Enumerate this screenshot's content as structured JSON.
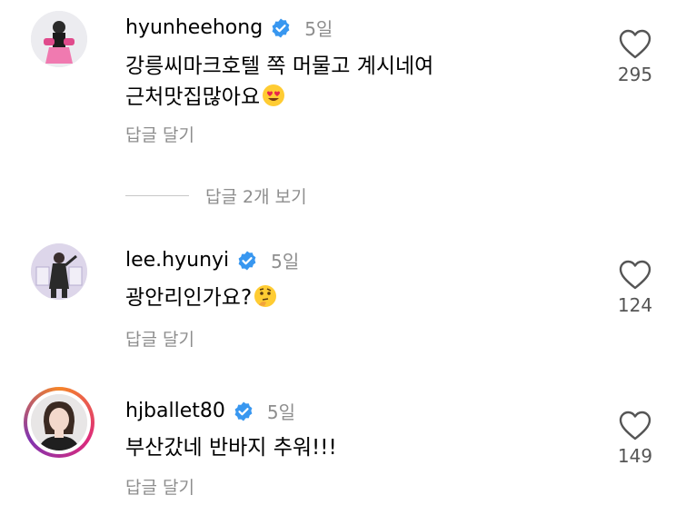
{
  "colors": {
    "verified": "#3897f0",
    "secondary_text": "#8e8e8e",
    "ring_start": "#f58529",
    "ring_end": "#8134af"
  },
  "comments": [
    {
      "username": "hyunheehong",
      "time": "5일",
      "text_line1": "강릉씨마크호텔 쪽 머물고 계시네여",
      "text_line2": "근처맛집많아요",
      "emoji": "heart-eyes-emoji",
      "reply_label": "답글 달기",
      "likes": "295"
    },
    {
      "username": "lee.hyunyi",
      "time": "5일",
      "text_line1": "광안리인가요?",
      "emoji": "thinking-face-emoji",
      "reply_label": "답글 달기",
      "likes": "124"
    },
    {
      "username": "hjballet80",
      "time": "5일",
      "text_line1": "부산갔네 반바지 추워!!!",
      "reply_label": "답글 달기",
      "likes": "149"
    }
  ],
  "view_replies_label": "답글 2개 보기"
}
